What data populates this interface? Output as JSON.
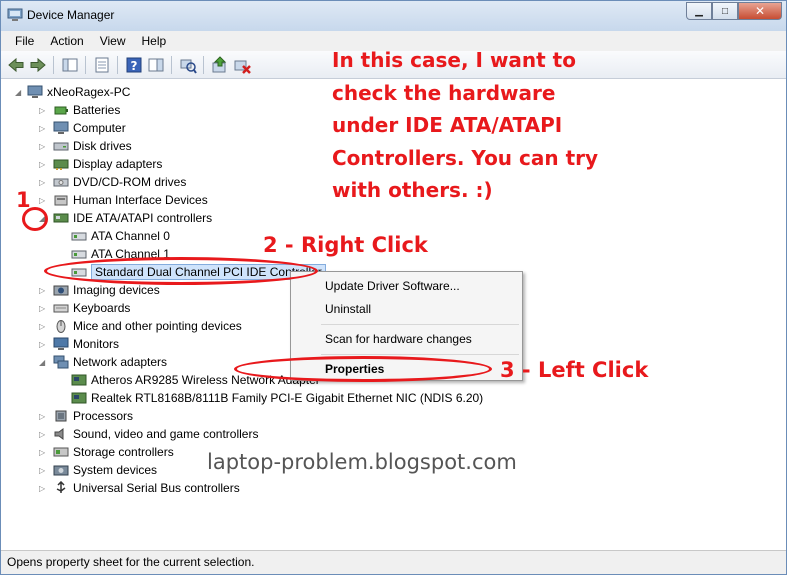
{
  "window": {
    "title": "Device Manager"
  },
  "window_buttons": {
    "minimize": "▁",
    "maximize": "□",
    "close": "✕"
  },
  "menu": [
    "File",
    "Action",
    "View",
    "Help"
  ],
  "tree": {
    "root": "xNeoRagex-PC",
    "items": [
      "Batteries",
      "Computer",
      "Disk drives",
      "Display adapters",
      "DVD/CD-ROM drives",
      "Human Interface Devices",
      "IDE ATA/ATAPI controllers",
      "ATA Channel 0",
      "ATA Channel 1",
      "Standard Dual Channel PCI IDE Controller",
      "Imaging devices",
      "Keyboards",
      "Mice and other pointing devices",
      "Monitors",
      "Network adapters",
      "Atheros AR9285 Wireless Network Adapter",
      "Realtek RTL8168B/8111B Family PCI-E Gigabit Ethernet NIC (NDIS 6.20)",
      "Processors",
      "Sound, video and game controllers",
      "Storage controllers",
      "System devices",
      "Universal Serial Bus controllers"
    ]
  },
  "context_menu": {
    "update": "Update Driver Software...",
    "uninstall": "Uninstall",
    "scan": "Scan for hardware changes",
    "properties": "Properties"
  },
  "status": "Opens property sheet for the current selection.",
  "annotations": {
    "main": "In this case, I want to check the hardware under IDE ATA/ATAPI Controllers. You can try with others. :)",
    "step1": "1",
    "step2": "2 - Right Click",
    "step3": "3 - Left Click",
    "watermark": "laptop-problem.blogspot.com"
  },
  "colors": {
    "annotation_red": "#e8191c",
    "selection": "#cfe3fb"
  }
}
